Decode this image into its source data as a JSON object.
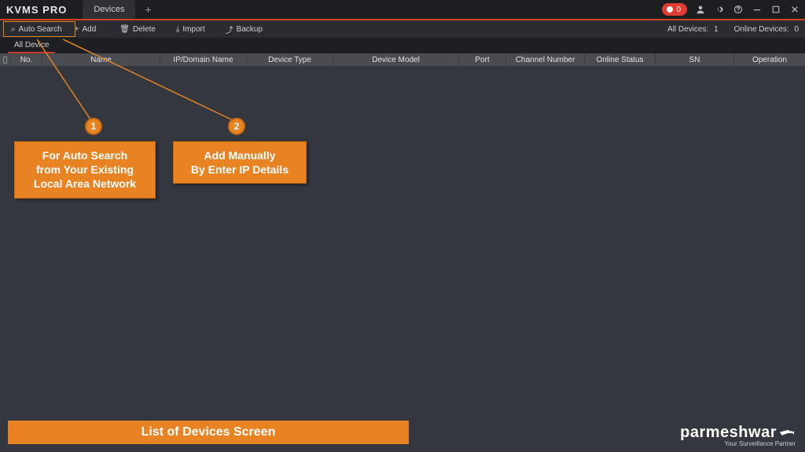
{
  "brand": "KVMS PRO",
  "tabs": {
    "devices": "Devices"
  },
  "rec": {
    "count": "0"
  },
  "toolbar": {
    "auto_search": "Auto Search",
    "add": "Add",
    "delete": "Delete",
    "import": "Import",
    "backup": "Backup"
  },
  "stats": {
    "all_label": "All Devices:",
    "all_count": "1",
    "online_label": "Online Devices:",
    "online_count": "0"
  },
  "subtab": {
    "all_device": "All Device"
  },
  "columns": {
    "no": "No.",
    "name": "Name",
    "ip": "IP/Domain Name",
    "type": "Device Type",
    "model": "Device Model",
    "port": "Port",
    "channel": "Channel Number",
    "status": "Online Status",
    "sn": "SN",
    "op": "Operation"
  },
  "ann": {
    "badge1": "1",
    "badge2": "2",
    "box1_l1": "For Auto Search",
    "box1_l2": "from Your Existing",
    "box1_l3": "Local Area Network",
    "box2_l1": "Add Manually",
    "box2_l2": "By Enter IP Details"
  },
  "banner": "List of Devices Screen",
  "watermark": {
    "main": "parmeshwar",
    "sub": "Your Surveillance Partner"
  }
}
